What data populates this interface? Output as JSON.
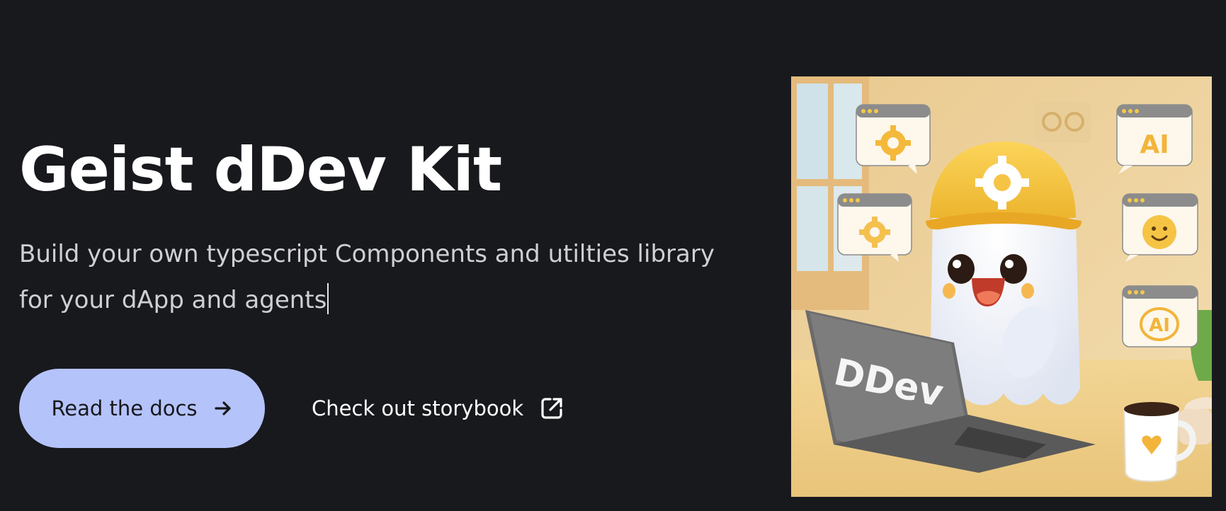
{
  "hero": {
    "title": "Geist dDev Kit",
    "subtitle": "Build your own typescript Components and utilties library for your dApp and agents",
    "primary_button": {
      "label": "Read the docs",
      "icon": "arrow-right-icon"
    },
    "secondary_link": {
      "label": "Check out storybook",
      "icon": "external-link-icon"
    }
  },
  "illustration": {
    "laptop_text": "DDev",
    "bubble_ai_text": "AI",
    "bubble_ai_circle_text": "AI"
  },
  "colors": {
    "background": "#18191d",
    "primary_button": "#b5c3fb",
    "title": "#ffffff",
    "subtitle": "#cfcfd4"
  }
}
